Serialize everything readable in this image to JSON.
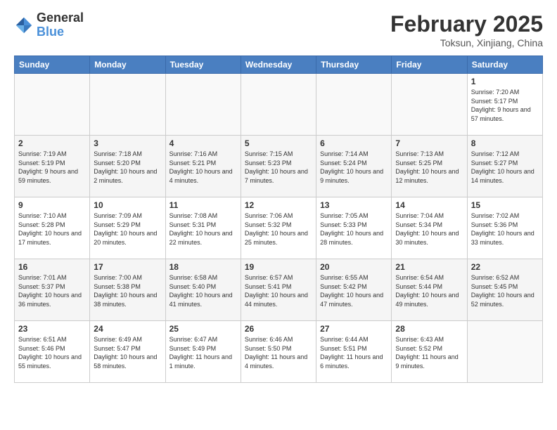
{
  "logo": {
    "general": "General",
    "blue": "Blue"
  },
  "title": {
    "month": "February 2025",
    "location": "Toksun, Xinjiang, China"
  },
  "weekdays": [
    "Sunday",
    "Monday",
    "Tuesday",
    "Wednesday",
    "Thursday",
    "Friday",
    "Saturday"
  ],
  "weeks": [
    {
      "shaded": false,
      "days": [
        {
          "num": "",
          "info": ""
        },
        {
          "num": "",
          "info": ""
        },
        {
          "num": "",
          "info": ""
        },
        {
          "num": "",
          "info": ""
        },
        {
          "num": "",
          "info": ""
        },
        {
          "num": "",
          "info": ""
        },
        {
          "num": "1",
          "info": "Sunrise: 7:20 AM\nSunset: 5:17 PM\nDaylight: 9 hours\nand 57 minutes."
        }
      ]
    },
    {
      "shaded": true,
      "days": [
        {
          "num": "2",
          "info": "Sunrise: 7:19 AM\nSunset: 5:19 PM\nDaylight: 9 hours\nand 59 minutes."
        },
        {
          "num": "3",
          "info": "Sunrise: 7:18 AM\nSunset: 5:20 PM\nDaylight: 10 hours\nand 2 minutes."
        },
        {
          "num": "4",
          "info": "Sunrise: 7:16 AM\nSunset: 5:21 PM\nDaylight: 10 hours\nand 4 minutes."
        },
        {
          "num": "5",
          "info": "Sunrise: 7:15 AM\nSunset: 5:23 PM\nDaylight: 10 hours\nand 7 minutes."
        },
        {
          "num": "6",
          "info": "Sunrise: 7:14 AM\nSunset: 5:24 PM\nDaylight: 10 hours\nand 9 minutes."
        },
        {
          "num": "7",
          "info": "Sunrise: 7:13 AM\nSunset: 5:25 PM\nDaylight: 10 hours\nand 12 minutes."
        },
        {
          "num": "8",
          "info": "Sunrise: 7:12 AM\nSunset: 5:27 PM\nDaylight: 10 hours\nand 14 minutes."
        }
      ]
    },
    {
      "shaded": false,
      "days": [
        {
          "num": "9",
          "info": "Sunrise: 7:10 AM\nSunset: 5:28 PM\nDaylight: 10 hours\nand 17 minutes."
        },
        {
          "num": "10",
          "info": "Sunrise: 7:09 AM\nSunset: 5:29 PM\nDaylight: 10 hours\nand 20 minutes."
        },
        {
          "num": "11",
          "info": "Sunrise: 7:08 AM\nSunset: 5:31 PM\nDaylight: 10 hours\nand 22 minutes."
        },
        {
          "num": "12",
          "info": "Sunrise: 7:06 AM\nSunset: 5:32 PM\nDaylight: 10 hours\nand 25 minutes."
        },
        {
          "num": "13",
          "info": "Sunrise: 7:05 AM\nSunset: 5:33 PM\nDaylight: 10 hours\nand 28 minutes."
        },
        {
          "num": "14",
          "info": "Sunrise: 7:04 AM\nSunset: 5:34 PM\nDaylight: 10 hours\nand 30 minutes."
        },
        {
          "num": "15",
          "info": "Sunrise: 7:02 AM\nSunset: 5:36 PM\nDaylight: 10 hours\nand 33 minutes."
        }
      ]
    },
    {
      "shaded": true,
      "days": [
        {
          "num": "16",
          "info": "Sunrise: 7:01 AM\nSunset: 5:37 PM\nDaylight: 10 hours\nand 36 minutes."
        },
        {
          "num": "17",
          "info": "Sunrise: 7:00 AM\nSunset: 5:38 PM\nDaylight: 10 hours\nand 38 minutes."
        },
        {
          "num": "18",
          "info": "Sunrise: 6:58 AM\nSunset: 5:40 PM\nDaylight: 10 hours\nand 41 minutes."
        },
        {
          "num": "19",
          "info": "Sunrise: 6:57 AM\nSunset: 5:41 PM\nDaylight: 10 hours\nand 44 minutes."
        },
        {
          "num": "20",
          "info": "Sunrise: 6:55 AM\nSunset: 5:42 PM\nDaylight: 10 hours\nand 47 minutes."
        },
        {
          "num": "21",
          "info": "Sunrise: 6:54 AM\nSunset: 5:44 PM\nDaylight: 10 hours\nand 49 minutes."
        },
        {
          "num": "22",
          "info": "Sunrise: 6:52 AM\nSunset: 5:45 PM\nDaylight: 10 hours\nand 52 minutes."
        }
      ]
    },
    {
      "shaded": false,
      "days": [
        {
          "num": "23",
          "info": "Sunrise: 6:51 AM\nSunset: 5:46 PM\nDaylight: 10 hours\nand 55 minutes."
        },
        {
          "num": "24",
          "info": "Sunrise: 6:49 AM\nSunset: 5:47 PM\nDaylight: 10 hours\nand 58 minutes."
        },
        {
          "num": "25",
          "info": "Sunrise: 6:47 AM\nSunset: 5:49 PM\nDaylight: 11 hours\nand 1 minute."
        },
        {
          "num": "26",
          "info": "Sunrise: 6:46 AM\nSunset: 5:50 PM\nDaylight: 11 hours\nand 4 minutes."
        },
        {
          "num": "27",
          "info": "Sunrise: 6:44 AM\nSunset: 5:51 PM\nDaylight: 11 hours\nand 6 minutes."
        },
        {
          "num": "28",
          "info": "Sunrise: 6:43 AM\nSunset: 5:52 PM\nDaylight: 11 hours\nand 9 minutes."
        },
        {
          "num": "",
          "info": ""
        }
      ]
    }
  ]
}
